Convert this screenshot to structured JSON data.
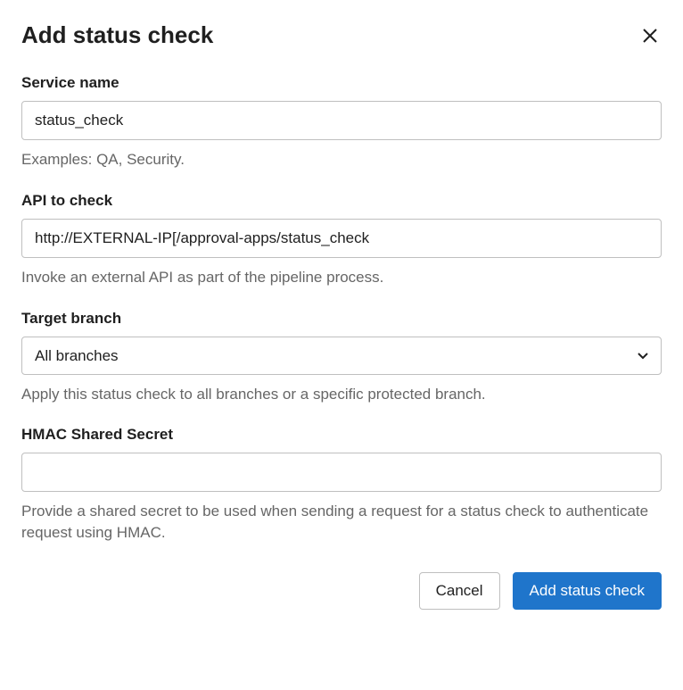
{
  "dialog": {
    "title": "Add status check"
  },
  "fields": {
    "service_name": {
      "label": "Service name",
      "value": "status_check",
      "help": "Examples: QA, Security."
    },
    "api": {
      "label": "API to check",
      "value": "http://EXTERNAL-IP[/approval-apps/status_check",
      "help": "Invoke an external API as part of the pipeline process."
    },
    "target_branch": {
      "label": "Target branch",
      "selected": "All branches",
      "help": "Apply this status check to all branches or a specific protected branch."
    },
    "hmac": {
      "label": "HMAC Shared Secret",
      "value": "",
      "help": "Provide a shared secret to be used when sending a request for a status check to authenticate request using HMAC."
    }
  },
  "actions": {
    "cancel": "Cancel",
    "submit": "Add status check"
  }
}
